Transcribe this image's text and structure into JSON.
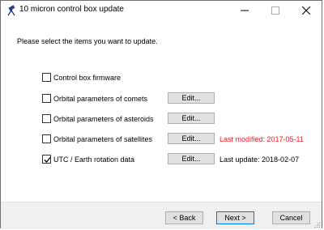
{
  "window": {
    "title": "10 micron control box update"
  },
  "content": {
    "instruction": "Please select the items you want to update."
  },
  "items": [
    {
      "label": "Control box firmware",
      "checked": false,
      "has_edit": false,
      "status": ""
    },
    {
      "label": "Orbital parameters of comets",
      "checked": false,
      "has_edit": true,
      "status": ""
    },
    {
      "label": "Orbital parameters of asteroids",
      "checked": false,
      "has_edit": true,
      "status": ""
    },
    {
      "label": "Orbital parameters of satellites",
      "checked": false,
      "has_edit": true,
      "status": "Last modified: 2017-05-11",
      "status_color": "#e8202a"
    },
    {
      "label": "UTC / Earth rotation data",
      "checked": true,
      "has_edit": true,
      "status": "Last update: 2018-02-07",
      "status_color": "#000000"
    }
  ],
  "buttons": {
    "edit_label": "Edit...",
    "back_label": "< Back",
    "next_label": "Next >",
    "cancel_label": "Cancel"
  },
  "icons": {
    "app": "telescope-icon",
    "minimize": "minimize-icon",
    "maximize": "maximize-icon",
    "close": "close-icon",
    "check": "checkmark-icon",
    "grip": "resize-grip-icon"
  }
}
